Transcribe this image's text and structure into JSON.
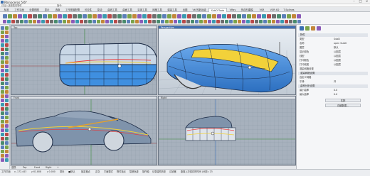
{
  "window": {
    "title": "Rhinoceros 5/6*",
    "min": "–",
    "max": "□",
    "close": "×"
  },
  "commandbar": {
    "line1": "已加入选取集的物件",
    "prompt": "指令:"
  },
  "tabs": [
    "标准",
    "工作平面",
    "设置视图",
    "显示",
    "选取",
    "工作视窗配置",
    "可见性",
    "变动",
    "曲线工具",
    "曲面工具",
    "实体工具",
    "网格工具",
    "渲染工具",
    "出图",
    "V6 的新功能",
    "SubD Tools",
    "VRay",
    "多边形建模",
    "VSR",
    "VSR 4D",
    "T-Splines"
  ],
  "active_tab_index": 15,
  "viewports": {
    "top": "Top",
    "perspective": "Perspective",
    "front": "Front",
    "right": "Right"
  },
  "rightpanel": {
    "section_props": "物件",
    "rows": [
      {
        "label": "类型",
        "value": "SubD"
      },
      {
        "label": "名称",
        "value": "open SubD"
      },
      {
        "label": "图层",
        "value": "默认"
      },
      {
        "label": "显示颜色",
        "value": "以图层"
      },
      {
        "label": "线型",
        "value": "以图层"
      },
      {
        "label": "打印颜色",
        "value": "以图层"
      },
      {
        "label": "打印线宽",
        "value": "以图层"
      },
      {
        "label": "渲染网格设置",
        "value": ""
      }
    ],
    "section_render": "渲染网格设置",
    "render_rows": [
      {
        "label": "自定义网格",
        "value": ""
      },
      {
        "label": "平滑",
        "value": "开"
      }
    ],
    "section_analysis": "曲率分析设置",
    "analysis_rows": [
      {
        "label": "最小曲率",
        "value": "0.0"
      },
      {
        "label": "最大曲率",
        "value": "0.0"
      }
    ],
    "btn_match": "匹配",
    "btn_details": "详细数据..."
  },
  "bottomtabs": [
    "透视",
    "Top",
    "Front",
    "Right",
    "+"
  ],
  "statusbar": {
    "cplane": "工作平面",
    "x": "x -172.443",
    "y": "y 61.808",
    "z": "z 0.000",
    "units": "毫米",
    "layer": "■默认",
    "snap": "锁定格点",
    "ortho": "正交",
    "planar": "平面模式",
    "osnap": "物件锁点",
    "smarttrack": "智慧轨迹",
    "gumball": "操作轴",
    "history": "记录建构历史",
    "filter": "过滤器",
    "time": "距离上次保存的时间 (分钟): 23"
  },
  "colors": {
    "accent": "#3f6fb5",
    "subd_blue": "#3f8fe0",
    "subd_highlight": "#f2d13a",
    "viewport_bg": "#9aa6b4"
  }
}
